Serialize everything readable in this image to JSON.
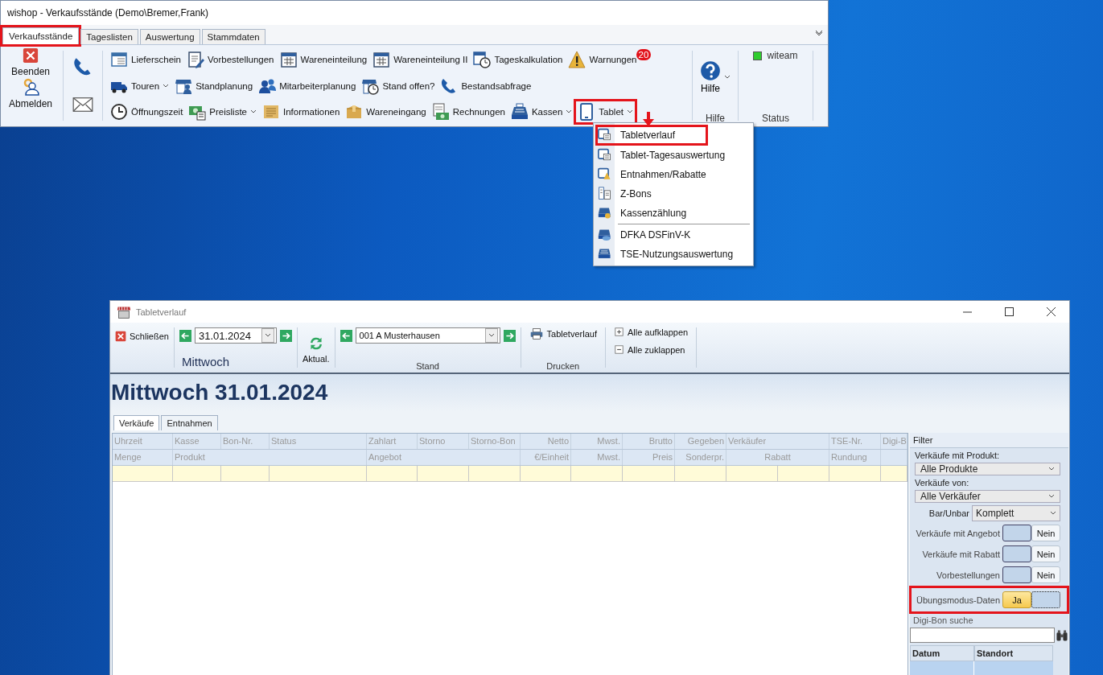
{
  "main_window": {
    "title": "wishop - Verkaufsstände (Demo\\Bremer,Frank)",
    "tabs": [
      {
        "label": "Verkaufsstände",
        "selected": true,
        "highlighted": true
      },
      {
        "label": "Tageslisten",
        "selected": false,
        "highlighted": false
      },
      {
        "label": "Auswertung",
        "selected": false,
        "highlighted": false
      },
      {
        "label": "Stammdaten",
        "selected": false,
        "highlighted": false
      }
    ],
    "session_buttons": [
      {
        "label": "Beenden"
      },
      {
        "label": "Abmelden"
      }
    ],
    "ribbon_rows": [
      [
        {
          "label": "Lieferschein",
          "dropdown": false
        },
        {
          "label": "Vorbestellungen",
          "dropdown": false
        },
        {
          "label": "Wareneinteilung",
          "dropdown": false
        },
        {
          "label": "Wareneinteilung II",
          "dropdown": false
        },
        {
          "label": "Tageskalkulation",
          "dropdown": false
        },
        {
          "label": "Warnungen",
          "dropdown": false,
          "badge": "20"
        }
      ],
      [
        {
          "label": "Touren",
          "dropdown": true
        },
        {
          "label": "Standplanung",
          "dropdown": false
        },
        {
          "label": "Mitarbeiterplanung",
          "dropdown": false
        },
        {
          "label": "Stand offen?",
          "dropdown": false
        },
        {
          "label": "Bestandsabfrage",
          "dropdown": false
        }
      ],
      [
        {
          "label": "Öffnungszeit",
          "dropdown": false
        },
        {
          "label": "Preisliste",
          "dropdown": true
        },
        {
          "label": "Informationen",
          "dropdown": false
        },
        {
          "label": "Wareneingang",
          "dropdown": false
        },
        {
          "label": "Rechnungen",
          "dropdown": false
        },
        {
          "label": "Kassen",
          "dropdown": true
        },
        {
          "label": "Tablet",
          "dropdown": true,
          "highlighted": true
        }
      ]
    ],
    "help": {
      "label": "Hilfe",
      "group": "Hilfe"
    },
    "status": {
      "user": "witeam",
      "online": true,
      "group": "Status"
    }
  },
  "menu": {
    "annotation_arrow": true,
    "items": [
      {
        "label": "Tabletverlauf",
        "highlighted": true
      },
      {
        "label": "Tablet-Tagesauswertung",
        "highlighted": false
      },
      {
        "label": "Entnahmen/Rabatte",
        "highlighted": false
      },
      {
        "label": "Z-Bons",
        "highlighted": false
      },
      {
        "label": "Kassenzählung",
        "highlighted": false
      },
      {
        "label": "DFKA DSFinV-K",
        "highlighted": false,
        "separator_before": true
      },
      {
        "label": "TSE-Nutzungsauswertung",
        "highlighted": false
      }
    ]
  },
  "tablet_window": {
    "title": "Tabletverlauf",
    "toolbar": {
      "close": "Schließen",
      "date": "31.01.2024",
      "weekday": "Mittwoch",
      "refresh": "Aktual.",
      "stand": "001 A Musterhausen",
      "stand_group": "Stand",
      "print": "Tabletverlauf",
      "print_group": "Drucken",
      "expand": "Alle aufklappen",
      "collapse": "Alle zuklappen"
    },
    "heading": "Mittwoch 31.01.2024",
    "tabs": [
      {
        "label": "Verkäufe",
        "selected": true
      },
      {
        "label": "Entnahmen",
        "selected": false
      }
    ],
    "table": {
      "columns": [
        "Uhrzeit",
        "Kasse",
        "Bon-Nr.",
        "Status",
        "Zahlart",
        "Storno",
        "Storno-Bon",
        "Netto",
        "Mwst.",
        "Brutto",
        "Gegeben",
        "Verkäufer",
        "TSE-Nr.",
        "Digi-B"
      ],
      "subcolumns": [
        "Menge",
        "Produkt",
        "Angebot",
        "€/Einheit",
        "Mwst.",
        "Preis",
        "Sonderpr.",
        "Rabatt",
        "Rundung"
      ]
    },
    "filter": {
      "title": "Filter",
      "product_label": "Verkäufe mit Produkt:",
      "product": "Alle Produkte",
      "seller_label": "Verkäufe von:",
      "seller": "Alle Verkäufer",
      "payment_label": "Bar/Unbar",
      "payment": "Komplett",
      "toggles": [
        {
          "label": "Verkäufe mit Angebot",
          "value": "Nein",
          "on": false,
          "highlighted": false
        },
        {
          "label": "Verkäufe mit Rabatt",
          "value": "Nein",
          "on": false,
          "highlighted": false
        },
        {
          "label": "Vorbestellungen",
          "value": "Nein",
          "on": false,
          "highlighted": false
        },
        {
          "label": "Übungsmodus-Daten",
          "value": "Ja",
          "on": true,
          "highlighted": true
        }
      ],
      "search_label": "Digi-Bon suche",
      "result_columns": [
        "Datum",
        "Standort"
      ]
    }
  }
}
